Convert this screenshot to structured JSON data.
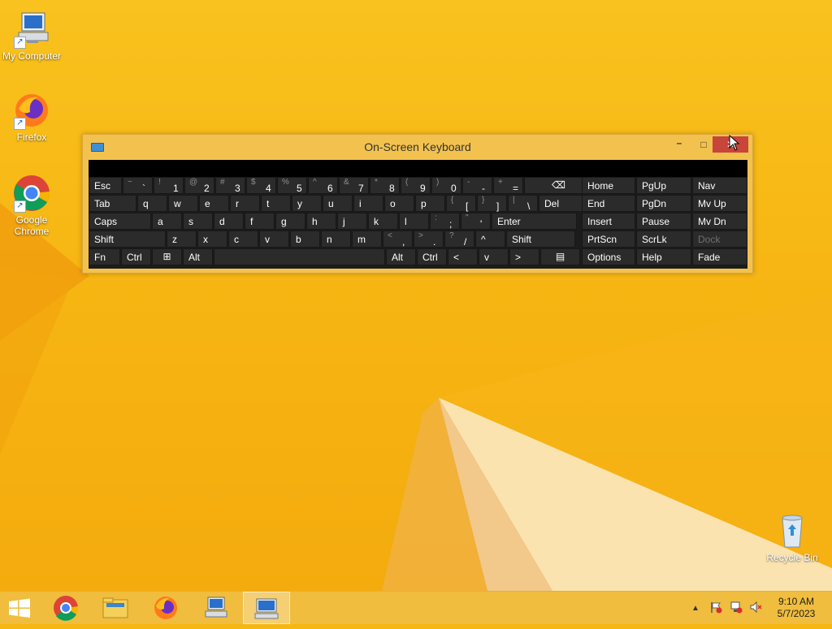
{
  "desktop": {
    "icons": [
      {
        "label": "My Computer",
        "icon": "computer-icon"
      },
      {
        "label": "Firefox",
        "icon": "firefox-icon"
      },
      {
        "label": "Google Chrome",
        "icon": "chrome-icon"
      },
      {
        "label": "Recycle Bin",
        "icon": "recycle-bin-icon"
      }
    ]
  },
  "osk": {
    "title": "On-Screen Keyboard",
    "controls": {
      "minimize": "–",
      "maximize": "□"
    },
    "rows": {
      "r1": [
        {
          "t": "Esc"
        },
        {
          "s": "~",
          "m": "`"
        },
        {
          "s": "!",
          "m": "1"
        },
        {
          "s": "@",
          "m": "2"
        },
        {
          "s": "#",
          "m": "3"
        },
        {
          "s": "$",
          "m": "4"
        },
        {
          "s": "%",
          "m": "5"
        },
        {
          "s": "^",
          "m": "6"
        },
        {
          "s": "&",
          "m": "7"
        },
        {
          "s": "*",
          "m": "8"
        },
        {
          "s": "(",
          "m": "9"
        },
        {
          "s": ")",
          "m": "0"
        },
        {
          "s": "-",
          "m": "-"
        },
        {
          "s": "+",
          "m": "="
        },
        {
          "icon": "backspace-icon"
        }
      ],
      "r2": [
        {
          "t": "Tab"
        },
        {
          "t": "q"
        },
        {
          "t": "w"
        },
        {
          "t": "e"
        },
        {
          "t": "r"
        },
        {
          "t": "t"
        },
        {
          "t": "y"
        },
        {
          "t": "u"
        },
        {
          "t": "i"
        },
        {
          "t": "o"
        },
        {
          "t": "p"
        },
        {
          "s": "{",
          "m": "["
        },
        {
          "s": "}",
          "m": "]"
        },
        {
          "s": "|",
          "m": "\\"
        },
        {
          "t": "Del"
        }
      ],
      "r3": [
        {
          "t": "Caps"
        },
        {
          "t": "a"
        },
        {
          "t": "s"
        },
        {
          "t": "d"
        },
        {
          "t": "f"
        },
        {
          "t": "g"
        },
        {
          "t": "h"
        },
        {
          "t": "j"
        },
        {
          "t": "k"
        },
        {
          "t": "l"
        },
        {
          "s": ":",
          "m": ";"
        },
        {
          "s": "\"",
          "m": "'"
        },
        {
          "t": "Enter"
        }
      ],
      "r4": [
        {
          "t": "Shift"
        },
        {
          "t": "z"
        },
        {
          "t": "x"
        },
        {
          "t": "c"
        },
        {
          "t": "v"
        },
        {
          "t": "b"
        },
        {
          "t": "n"
        },
        {
          "t": "m"
        },
        {
          "s": "<",
          "m": ","
        },
        {
          "s": ">",
          "m": "."
        },
        {
          "s": "?",
          "m": "/"
        },
        {
          "t": "^"
        },
        {
          "t": "Shift"
        }
      ],
      "r5": [
        {
          "t": "Fn"
        },
        {
          "t": "Ctrl"
        },
        {
          "icon": "windows-logo-icon"
        },
        {
          "t": "Alt"
        },
        {
          "t": ""
        },
        {
          "t": "Alt"
        },
        {
          "t": "Ctrl"
        },
        {
          "t": "<"
        },
        {
          "t": "v"
        },
        {
          "t": ">"
        },
        {
          "icon": "menu-icon"
        }
      ]
    },
    "nav": [
      [
        "Home",
        "PgUp",
        "Nav"
      ],
      [
        "End",
        "PgDn",
        "Mv Up"
      ],
      [
        "Insert",
        "Pause",
        "Mv Dn"
      ],
      [
        "PrtScn",
        "ScrLk",
        "Dock"
      ],
      [
        "Options",
        "Help",
        "Fade"
      ]
    ]
  },
  "taskbar": {
    "clock_time": "9:10 AM",
    "clock_date": "5/7/2023"
  }
}
